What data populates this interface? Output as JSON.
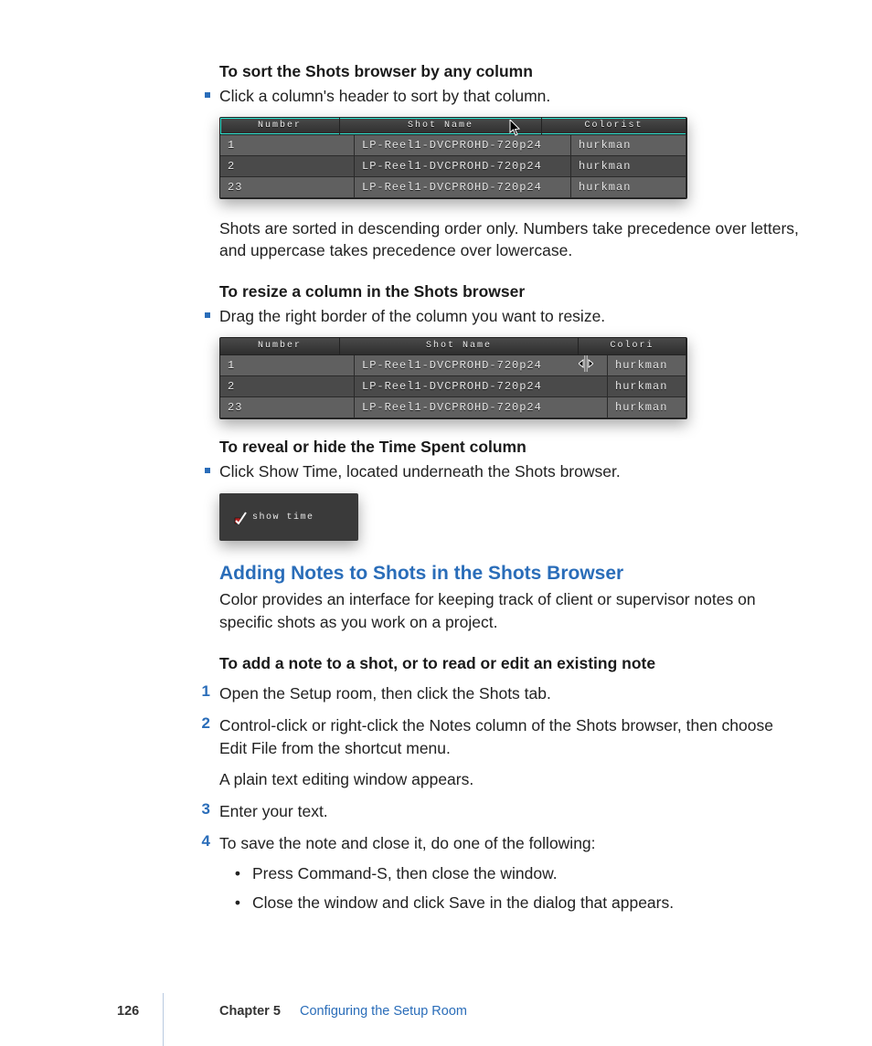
{
  "sections": {
    "sort_heading": "To sort the Shots browser by any column",
    "sort_bullet": "Click a column's header to sort by that column.",
    "sort_para": "Shots are sorted in descending order only. Numbers take precedence over letters, and uppercase takes precedence over lowercase.",
    "resize_heading": "To resize a column in the Shots browser",
    "resize_bullet": "Drag the right border of the column you want to resize.",
    "reveal_heading": "To reveal or hide the Time Spent column",
    "reveal_bullet": "Click Show Time, located underneath the Shots browser.",
    "showtime_label": "show time",
    "notes_heading": "Adding Notes to Shots in the Shots Browser",
    "notes_intro": "Color provides an interface for keeping track of client or supervisor notes on specific shots as you work on a project.",
    "add_note_heading": "To add a note to a shot, or to read or edit an existing note",
    "step1": "Open the Setup room, then click the Shots tab.",
    "step2": "Control-click or right-click the Notes column of the Shots browser, then choose Edit File from the shortcut menu.",
    "step2_after": "A plain text editing window appears.",
    "step3": "Enter your text.",
    "step4": "To save the note and close it, do one of the following:",
    "step4a": "Press Command-S, then close the window.",
    "step4b": "Close the window and click Save in the dialog that appears."
  },
  "screenshots": {
    "table1": {
      "headers": {
        "number": "Number",
        "shot_name": "Shot Name",
        "colorist": "Colorist"
      },
      "rows": [
        {
          "num": "1",
          "name": "LP-Reel1-DVCPROHD-720p24",
          "colorist": "hurkman"
        },
        {
          "num": "2",
          "name": "LP-Reel1-DVCPROHD-720p24",
          "colorist": "hurkman"
        },
        {
          "num": "23",
          "name": "LP-Reel1-DVCPROHD-720p24",
          "colorist": "hurkman"
        }
      ]
    },
    "table2": {
      "headers": {
        "number": "Number",
        "shot_name": "Shot Name",
        "colorist": "Colori"
      },
      "rows": [
        {
          "num": "1",
          "name": "LP-Reel1-DVCPROHD-720p24",
          "colorist": "hurkman"
        },
        {
          "num": "2",
          "name": "LP-Reel1-DVCPROHD-720p24",
          "colorist": "hurkman"
        },
        {
          "num": "23",
          "name": "LP-Reel1-DVCPROHD-720p24",
          "colorist": "hurkman"
        }
      ]
    }
  },
  "footer": {
    "page": "126",
    "chapter": "Chapter 5",
    "title": "Configuring the Setup Room"
  }
}
